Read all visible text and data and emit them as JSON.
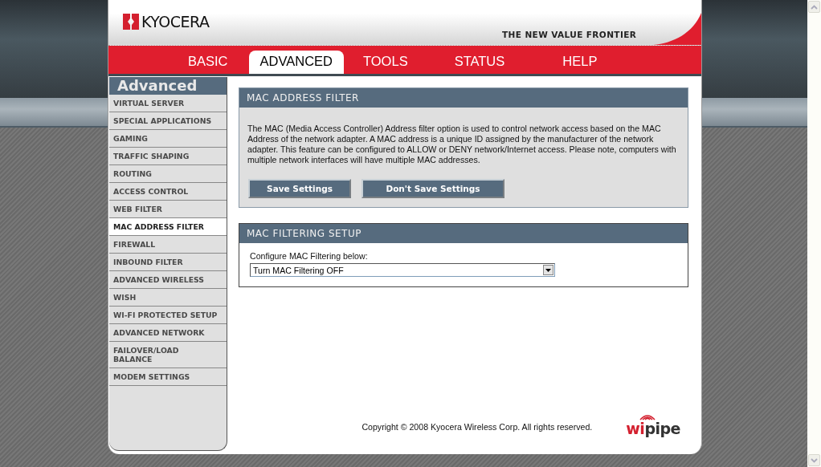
{
  "header": {
    "logo": "KYOCERA",
    "tagline": "THE NEW VALUE FRONTIER"
  },
  "tabs": [
    {
      "label": "BASIC",
      "selected": false
    },
    {
      "label": "ADVANCED",
      "selected": true
    },
    {
      "label": "TOOLS",
      "selected": false
    },
    {
      "label": "STATUS",
      "selected": false
    },
    {
      "label": "HELP",
      "selected": false
    }
  ],
  "sidebar": {
    "title": "Advanced",
    "items": [
      {
        "label": "VIRTUAL SERVER",
        "selected": false
      },
      {
        "label": "SPECIAL APPLICATIONS",
        "selected": false
      },
      {
        "label": "GAMING",
        "selected": false
      },
      {
        "label": "TRAFFIC SHAPING",
        "selected": false
      },
      {
        "label": "ROUTING",
        "selected": false
      },
      {
        "label": "ACCESS CONTROL",
        "selected": false
      },
      {
        "label": "WEB FILTER",
        "selected": false
      },
      {
        "label": "MAC ADDRESS FILTER",
        "selected": true
      },
      {
        "label": "FIREWALL",
        "selected": false
      },
      {
        "label": "INBOUND FILTER",
        "selected": false
      },
      {
        "label": "ADVANCED WIRELESS",
        "selected": false
      },
      {
        "label": "WISH",
        "selected": false
      },
      {
        "label": "WI-FI PROTECTED SETUP",
        "selected": false
      },
      {
        "label": "ADVANCED NETWORK",
        "selected": false
      },
      {
        "label": "FAILOVER/LOAD BALANCE",
        "selected": false
      },
      {
        "label": "MODEM SETTINGS",
        "selected": false
      }
    ]
  },
  "filter_panel": {
    "title": "MAC ADDRESS FILTER",
    "description": "The MAC (Media Access Controller) Address filter option is used to control network access based on the MAC Address of the network adapter. A MAC address is a unique ID assigned by the manufacturer of the network adapter. This feature can be configured to ALLOW or DENY network/Internet access. Please note, computers with multiple network interfaces will have multiple MAC addresses.",
    "buttons": [
      "Save Settings",
      "Don't Save Settings"
    ]
  },
  "setup_panel": {
    "title": "MAC FILTERING SETUP",
    "label": "Configure MAC Filtering below:",
    "select_value": "Turn MAC Filtering OFF"
  },
  "footer": {
    "copyright": "Copyright © 2008 Kyocera Wireless Corp. All rights reserved.",
    "logo_accent": "wi",
    "logo_rest": "pipe"
  }
}
